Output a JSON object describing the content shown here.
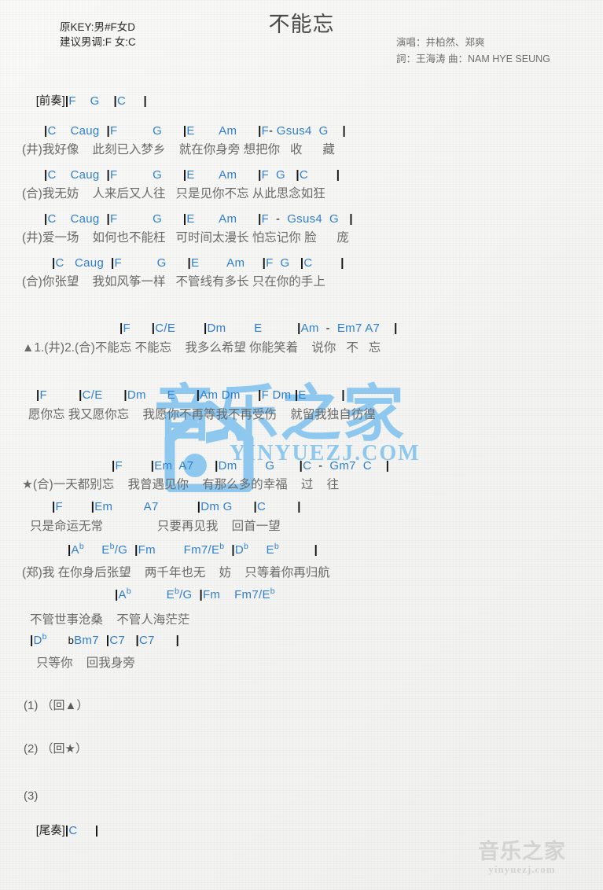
{
  "header": {
    "key_original": "原KEY:男#F女D",
    "key_suggested": "建议男调:F 女:C",
    "title": "不能忘",
    "singer_line": "演唱：井柏然、郑爽",
    "writer_line": "詞：王海涛  曲：NAM HYE SEUNG"
  },
  "colors": {
    "chord": "#2f7fd0",
    "lyric": "#6a6a6a",
    "bar": "#111111",
    "watermark_blue": "#8ec8ee",
    "watermark_grey": "#d3d3d1",
    "paper": "#f4f4f2"
  },
  "intro": {
    "label": "[前奏]",
    "chords": "|F    G    |C     |"
  },
  "rows": [
    {
      "kind": "chord",
      "text": "|C    Caug  |F          G      |E       Am      |F- Gsus4  G    |"
    },
    {
      "kind": "lyric",
      "text": "(井)我好像    此刻已入梦乡    就在你身旁 想把你   收      藏"
    },
    {
      "kind": "chord",
      "text": "|C    Caug  |F          G      |E       Am      |F  G   |C        |"
    },
    {
      "kind": "lyric",
      "text": "(合)我无妨    人来后又人往   只是见你不忘 从此思念如狂"
    },
    {
      "kind": "chord",
      "text": "|C    Caug  |F          G      |E       Am      |F  -  Gsus4  G   |"
    },
    {
      "kind": "lyric",
      "text": "(井)爱一场    如何也不能枉   可时间太漫长 怕忘记你 脸      庞"
    },
    {
      "kind": "chord",
      "text": "|C   Caug  |F          G      |E        Am     |F  G   |C        |"
    },
    {
      "kind": "lyric",
      "text": "(合)你张望    我如风筝一样   不管线有多长 只在你的手上"
    },
    {
      "kind": "chord",
      "text": "|F      |C/E        |Dm        E          |Am  -  Em7 A7    |"
    },
    {
      "kind": "lyric",
      "text": "▲1.(井)2.(合)不能忘 不能忘    我多么希望 你能笑着    说你   不   忘"
    },
    {
      "kind": "chord",
      "text": "|F         |C/E      |Dm      E      |Am Dm     |F Dm |E          |"
    },
    {
      "kind": "lyric",
      "text": "愿你忘 我又愿你忘    我愿你不再等我不再受伤    就留我独自彷徨"
    },
    {
      "kind": "chord",
      "text": "|F        |Em  A7      |Dm        G       |C  -  Gm7  C    |"
    },
    {
      "kind": "lyric",
      "text": "★(合)一天都别忘    我曾遇见你    有那么多的幸福    过    往"
    },
    {
      "kind": "chord",
      "text": "|F        |Em         A7           |Dm G      |C         |"
    },
    {
      "kind": "lyric",
      "text": "只是命运无常                只要再见我    回首一望"
    },
    {
      "kind": "chord_flat",
      "text": "|A♭     E♭/G  |Fm        Fm7/E♭  |D♭     E♭          |"
    },
    {
      "kind": "lyric",
      "text": "(郑)我 在你身后张望    两千年也无    妨    只等着你再归航"
    },
    {
      "kind": "chord_flat",
      "text": "|A♭          E♭/G  |Fm    Fm7/E♭"
    },
    {
      "kind": "lyric",
      "text": "不管世事沧桑    不管人海茫茫"
    },
    {
      "kind": "chord_flat",
      "text": "|D♭      ♭Bm7  |C7   |C7      |"
    },
    {
      "kind": "lyric",
      "text": "只等你    回我身旁"
    }
  ],
  "endings": [
    {
      "num": "(1)",
      "text": "（回▲）"
    },
    {
      "num": "(2)",
      "text": "（回★）"
    },
    {
      "num": "(3)",
      "text": ""
    }
  ],
  "outro": {
    "label": "[尾奏]",
    "chords": "|C     |"
  },
  "watermark": {
    "center_main": "音乐之家",
    "center_sub": "YINYUEZJ.COM",
    "corner_main": "音乐之家",
    "corner_sub": "yinyuezj.com"
  }
}
